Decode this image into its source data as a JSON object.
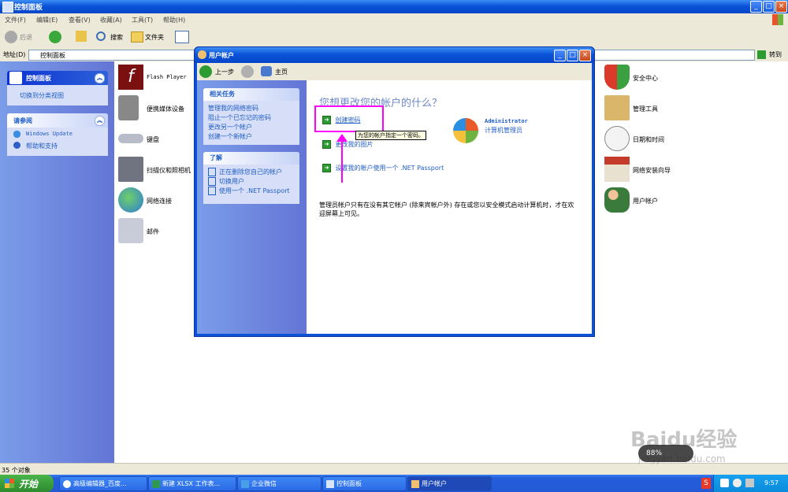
{
  "window": {
    "title": "控制面板",
    "minimize": "_",
    "maximize": "□",
    "close": "×"
  },
  "menu": [
    "文件(F)",
    "编辑(E)",
    "查看(V)",
    "收藏(A)",
    "工具(T)",
    "帮助(H)"
  ],
  "toolbar": {
    "back": "后退",
    "search": "搜索",
    "folders": "文件夹"
  },
  "address": {
    "label": "地址(D)",
    "value": "控制面板",
    "go": "转到"
  },
  "leftpane": {
    "panel1_title": "控制面板",
    "switch_view": "切换到分类视图",
    "panel2_title": "请参阅",
    "see_also": [
      "Windows Update",
      "帮助和支持"
    ]
  },
  "items_left": [
    "Flash Player",
    "便携媒体设备",
    "键盘",
    "扫描仪和照相机",
    "网络连接",
    "邮件"
  ],
  "items_right": [
    "安全中心",
    "管理工具",
    "日期和时间",
    "网络安装向导",
    "用户帐户"
  ],
  "dialog": {
    "title": "用户帐户",
    "back": "上一步",
    "home": "主页",
    "related_title": "相关任务",
    "related": [
      "管理我的网络密码",
      "阻止一个已忘记的密码",
      "更改另一个帐户",
      "创建一个新帐户"
    ],
    "learn_title": "了解",
    "learn": [
      "正在删除您自己的帐户",
      "切换用户",
      "使用一个 .NET Passport"
    ],
    "heading": "您想更改您的帐户的什么？",
    "actions": [
      "创建密码",
      "更改我的图片",
      "设置我的帐户使用一个 .NET Passport"
    ],
    "tooltip": "为您的帐户指定一个密码。",
    "account_name": "Administrator",
    "account_type": "计算机管理员",
    "note": "管理员帐户只有在没有其它帐户 (除来宾帐户外) 存在或您以安全模式启动计算机时，才在欢迎屏幕上可见。"
  },
  "status": "35 个对象",
  "taskbar": {
    "start": "开始",
    "tasks": [
      "高级编辑器_百度...",
      "新建 XLSX 工作表...",
      "企业微信",
      "控制面板",
      "用户帐户"
    ],
    "time": "9:57"
  },
  "watermark": {
    "brand": "Baidu经验",
    "url": "jingyan.baidu.com",
    "percent": "88%"
  },
  "colors": {
    "xp_blue": "#0a53d8",
    "link": "#215dc6",
    "highlight": "#ff00ff"
  }
}
